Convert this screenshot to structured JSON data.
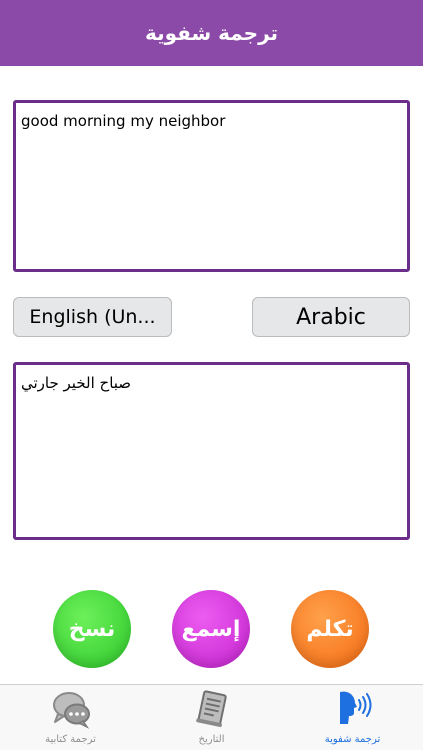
{
  "header": {
    "title": "ترجمة شفوية"
  },
  "source": {
    "text": "good morning my neighbor"
  },
  "languages": {
    "source_label": "English (Un...",
    "target_label": "Arabic"
  },
  "target": {
    "text": "صباح الخير جارتي"
  },
  "actions": {
    "copy_label": "نسخ",
    "listen_label": "إسمع",
    "speak_label": "تكلم"
  },
  "tabs": [
    {
      "label": "ترجمة كتابية",
      "icon": "chat-bubbles-icon",
      "active": false
    },
    {
      "label": "التاريخ",
      "icon": "document-list-icon",
      "active": false
    },
    {
      "label": "ترجمة شفوية",
      "icon": "speaking-head-icon",
      "active": true
    }
  ],
  "colors": {
    "header": "#8c4aa8",
    "border": "#6a2e8a",
    "copy": "#36d32e",
    "listen": "#d12ed8",
    "speak": "#f67a1e",
    "tab_active": "#1e6fe0",
    "tab_inactive": "#8f8f8f"
  }
}
